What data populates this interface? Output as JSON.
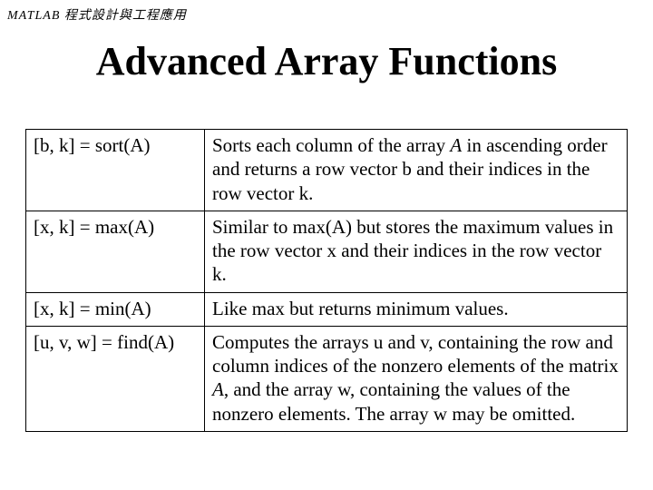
{
  "header": "MATLAB 程式設計與工程應用",
  "title": "Advanced Array Functions",
  "rows": [
    {
      "fn": "[b, k] = sort(A)",
      "desc_pre": "Sorts each column of the array ",
      "desc_A": "A",
      "desc_post": " in ascending order and returns a row vector b and their indices in the row vector k."
    },
    {
      "fn": "[x, k] = max(A)",
      "desc_pre": "Similar to max(A) but stores the maximum values in the row vector x and their indices in the row vector k.",
      "desc_A": "",
      "desc_post": ""
    },
    {
      "fn": "[x, k] = min(A)",
      "desc_pre": "Like max but returns minimum values.",
      "desc_A": "",
      "desc_post": ""
    },
    {
      "fn": "[u, v, w] = find(A)",
      "desc_pre": "Computes the arrays u and v, containing the row and column indices of the nonzero elements of the matrix ",
      "desc_A": "A",
      "desc_post": ", and the array w, containing the values of the nonzero elements. The array w may be omitted."
    }
  ]
}
